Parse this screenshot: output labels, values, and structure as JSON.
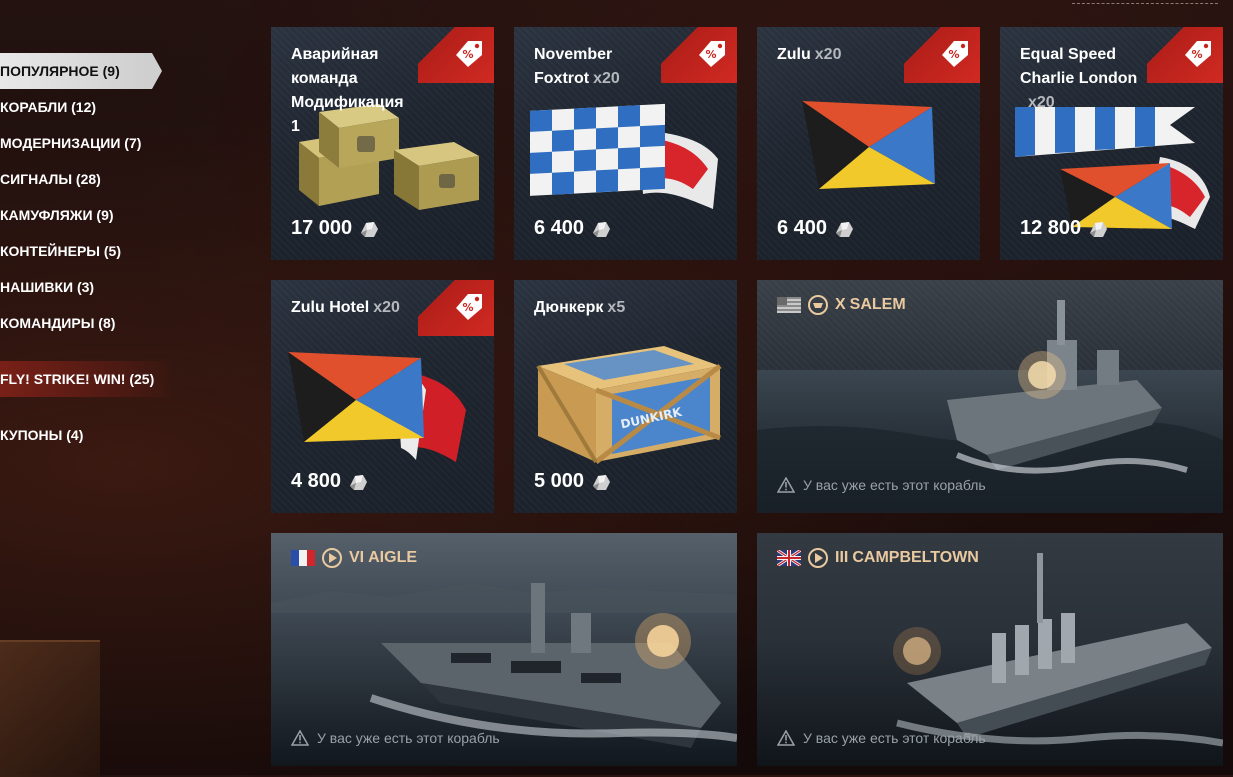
{
  "menu": [
    {
      "label": "ПОПУЛЯРНОЕ (9)",
      "active": true
    },
    {
      "label": "КОРАБЛИ (12)"
    },
    {
      "label": "МОДЕРНИЗАЦИИ (7)"
    },
    {
      "label": "СИГНАЛЫ (28)"
    },
    {
      "label": "КАМУФЛЯЖИ (9)"
    },
    {
      "label": "КОНТЕЙНЕРЫ (5)"
    },
    {
      "label": "НАШИВКИ (3)"
    },
    {
      "label": "КОМАНДИРЫ (8)"
    },
    {
      "label": "FLY! STRIKE! WIN! (25)"
    },
    {
      "label": "КУПОНЫ (4)"
    }
  ],
  "items": [
    {
      "title": "Аварийная команда Модификация 1",
      "qty": "",
      "price": "17 000",
      "icon": "supply-crates",
      "discount": true
    },
    {
      "title": "November Foxtrot",
      "qty": "x20",
      "price": "6 400",
      "icon": "signal-flag-checker",
      "discount": true
    },
    {
      "title": "Zulu",
      "qty": "x20",
      "price": "6 400",
      "icon": "signal-flag-zulu",
      "discount": true
    },
    {
      "title": "Equal Speed Charlie London",
      "qty": "x20",
      "price": "12 800",
      "icon": "signal-flags-combo",
      "discount": true
    },
    {
      "title": "Zulu Hotel",
      "qty": "x20",
      "price": "4 800",
      "icon": "signal-flag-zulu-hotel",
      "discount": true
    },
    {
      "title": "Дюнкерк",
      "qty": "x5",
      "price": "5 000",
      "icon": "dunkirk-crate",
      "discount": false
    }
  ],
  "crate_label": "DUNKIRK",
  "ships": [
    {
      "tier": "X",
      "name": "SALEM",
      "nation": "usa-flag",
      "type": "cruiser-icon",
      "note": "У вас уже есть этот корабль"
    },
    {
      "tier": "VI",
      "name": "AIGLE",
      "nation": "france-flag",
      "type": "destroyer-icon",
      "note": "У вас уже есть этот корабль"
    },
    {
      "tier": "III",
      "name": "CAMPBELTOWN",
      "nation": "uk-flag",
      "type": "destroyer-icon",
      "note": "У вас уже есть этот корабль"
    }
  ],
  "colors": {
    "ribbon": "#c8241c",
    "ship_name": "#e9c9a0",
    "note": "#9aa1a8",
    "menu_active_bg": "#dcdcdc"
  }
}
